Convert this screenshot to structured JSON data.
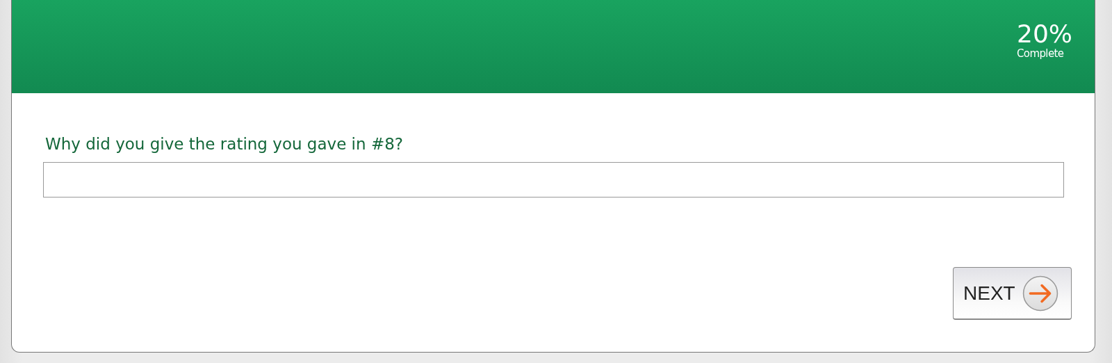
{
  "progress": {
    "percent": "20%",
    "label": "Complete"
  },
  "question": {
    "text": "Why did you give the rating you gave in #8?"
  },
  "buttons": [
    {
      "label": "NEXT",
      "kind": "next"
    }
  ]
}
